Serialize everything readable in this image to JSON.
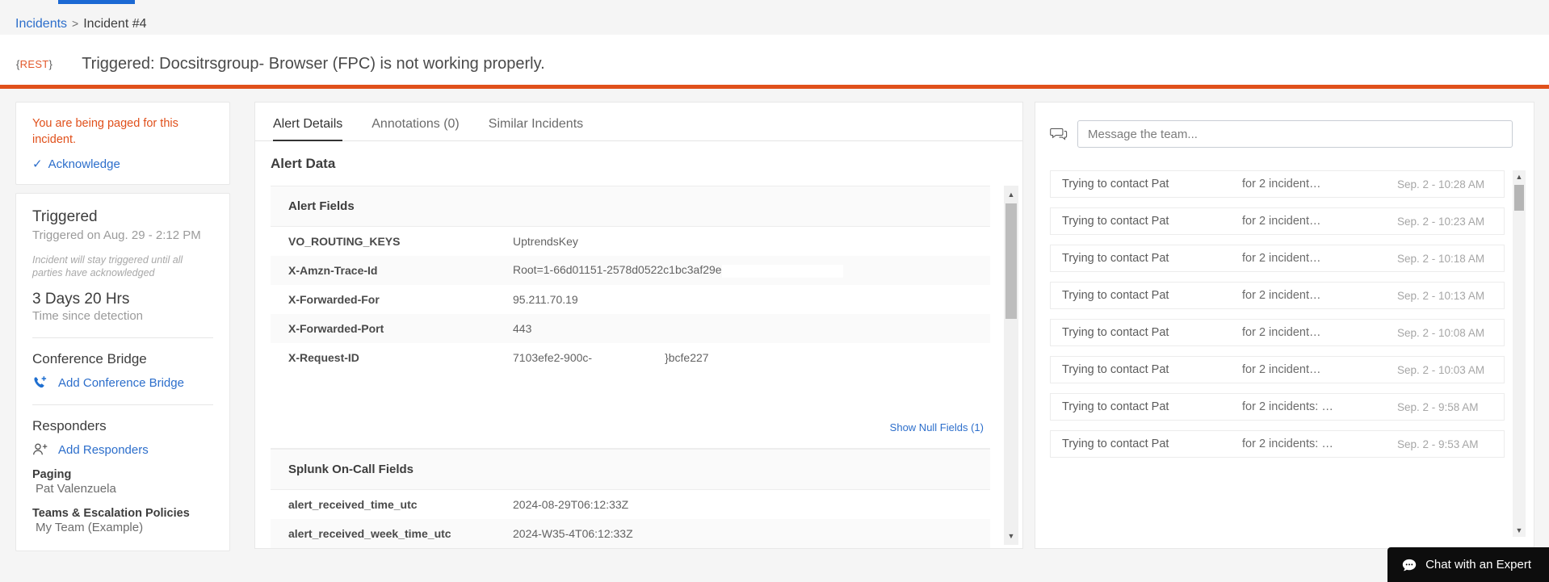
{
  "breadcrumb": {
    "root": "Incidents",
    "separator": ">",
    "current": "Incident #4"
  },
  "header": {
    "badge_open": "{",
    "badge_label": "REST",
    "badge_close": "}",
    "title": "Triggered: Docsitrsgroup- Browser (FPC) is not working properly.",
    "accent_color": "#e0501b"
  },
  "sidebar": {
    "paged_notice": "You are being paged for this incident.",
    "acknowledge_label": "Acknowledge",
    "acknowledge_check": "✓",
    "status_title": "Triggered",
    "status_subtitle": "Triggered on Aug. 29 - 2:12 PM",
    "status_note": "Incident will stay triggered until all parties have acknowledged",
    "elapsed_value": "3 Days 20 Hrs",
    "elapsed_label": "Time since detection",
    "conference_bridge_heading": "Conference Bridge",
    "add_conference_bridge_label": "Add Conference Bridge",
    "responders_heading": "Responders",
    "add_responders_label": "Add Responders",
    "paging_label": "Paging",
    "paging_value": "Pat Valenzuela",
    "teams_label": "Teams & Escalation Policies",
    "teams_value": "My Team (Example)"
  },
  "main": {
    "tabs": [
      {
        "label": "Alert Details",
        "active": true
      },
      {
        "label": "Annotations (0)",
        "active": false
      },
      {
        "label": "Similar Incidents",
        "active": false
      }
    ],
    "section_title": "Alert Data",
    "groups": [
      {
        "name": "Alert Fields",
        "rows": [
          {
            "key": "VO_ROUTING_KEYS",
            "value": "UptrendsKey",
            "masked": false
          },
          {
            "key": "X-Amzn-Trace-Id",
            "value": "Root=1-66d01151-2578d0522c1bc3af29e",
            "masked": true
          },
          {
            "key": "X-Forwarded-For",
            "value": "95.211.70.19",
            "masked": false
          },
          {
            "key": "X-Forwarded-Port",
            "value": "443",
            "masked": false
          },
          {
            "key": "X-Request-ID",
            "value": "7103efe2-900c-",
            "value_tail": "}bcfe227",
            "masked": false
          }
        ],
        "null_fields_link": "Show Null Fields (1)"
      },
      {
        "name": "Splunk On-Call Fields",
        "rows": [
          {
            "key": "alert_received_time_utc",
            "value": "2024-08-29T06:12:33Z",
            "masked": false
          },
          {
            "key": "alert_received_week_time_utc",
            "value": "2024-W35-4T06:12:33Z",
            "masked": false
          }
        ]
      }
    ]
  },
  "right": {
    "message_icon": "chat-bubbles-icon",
    "message_placeholder": "Message the team...",
    "messages": [
      {
        "who": "Trying to contact Pat",
        "what": "for 2 incident…",
        "when": "Sep. 2 - 10:28 AM"
      },
      {
        "who": "Trying to contact Pat",
        "what": "for 2 incident…",
        "when": "Sep. 2 - 10:23 AM"
      },
      {
        "who": "Trying to contact Pat",
        "what": "for 2 incident…",
        "when": "Sep. 2 - 10:18 AM"
      },
      {
        "who": "Trying to contact Pat",
        "what": "for 2 incident…",
        "when": "Sep. 2 - 10:13 AM"
      },
      {
        "who": "Trying to contact Pat",
        "what": "for 2 incident…",
        "when": "Sep. 2 - 10:08 AM"
      },
      {
        "who": "Trying to contact Pat",
        "what": "for 2 incident…",
        "when": "Sep. 2 - 10:03 AM"
      },
      {
        "who": "Trying to contact Pat",
        "what": "for 2 incidents: …",
        "when": "Sep. 2 - 9:58 AM"
      },
      {
        "who": "Trying to contact Pat",
        "what": "for 2 incidents: …",
        "when": "Sep. 2 - 9:53 AM"
      }
    ]
  },
  "chat_widget": {
    "label": "Chat with an Expert",
    "icon": "chat-dots-icon"
  },
  "scroll": {
    "up_arrow": "▲",
    "down_arrow": "▼"
  }
}
